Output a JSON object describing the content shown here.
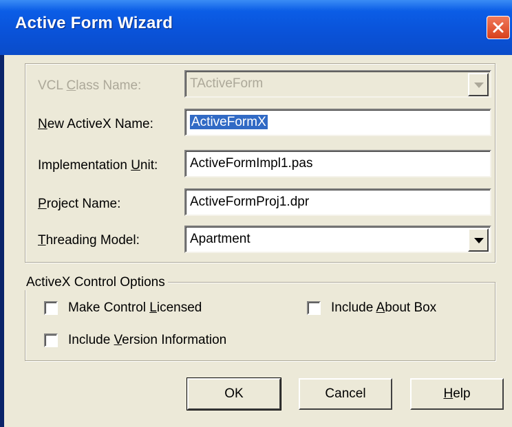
{
  "window": {
    "title": "Active Form Wizard"
  },
  "fields": {
    "vcl_class": {
      "label_pre": "VCL ",
      "label_mnemonic": "C",
      "label_post": "lass Name:",
      "value": "TActiveForm"
    },
    "activex_name": {
      "label_pre": "",
      "label_mnemonic": "N",
      "label_post": "ew ActiveX Name:",
      "value": "ActiveFormX"
    },
    "impl_unit": {
      "label_pre": "Implementation ",
      "label_mnemonic": "U",
      "label_post": "nit:",
      "value": "ActiveFormImpl1.pas"
    },
    "project_name": {
      "label_pre": "",
      "label_mnemonic": "P",
      "label_post": "roject Name:",
      "value": "ActiveFormProj1.dpr"
    },
    "threading_model": {
      "label_pre": "",
      "label_mnemonic": "T",
      "label_post": "hreading Model:",
      "value": "Apartment"
    }
  },
  "options": {
    "legend": "ActiveX Control Options",
    "licensed": {
      "pre": "Make Control ",
      "mnemonic": "L",
      "post": "icensed",
      "checked": false
    },
    "about_box": {
      "pre": "Include ",
      "mnemonic": "A",
      "post": "bout Box",
      "checked": false
    },
    "version_info": {
      "pre": "Include ",
      "mnemonic": "V",
      "post": "ersion Information",
      "checked": false
    }
  },
  "buttons": {
    "ok": "OK",
    "cancel": "Cancel",
    "help_mnemonic": "H",
    "help_post": "elp"
  },
  "colors": {
    "titlebar": "#0a52d8",
    "dialog_bg": "#ece9d8",
    "selection": "#316ac5",
    "close_button": "#e0522e"
  },
  "icons": {
    "close": "close-x-icon",
    "dropdown": "chevron-down-icon"
  }
}
